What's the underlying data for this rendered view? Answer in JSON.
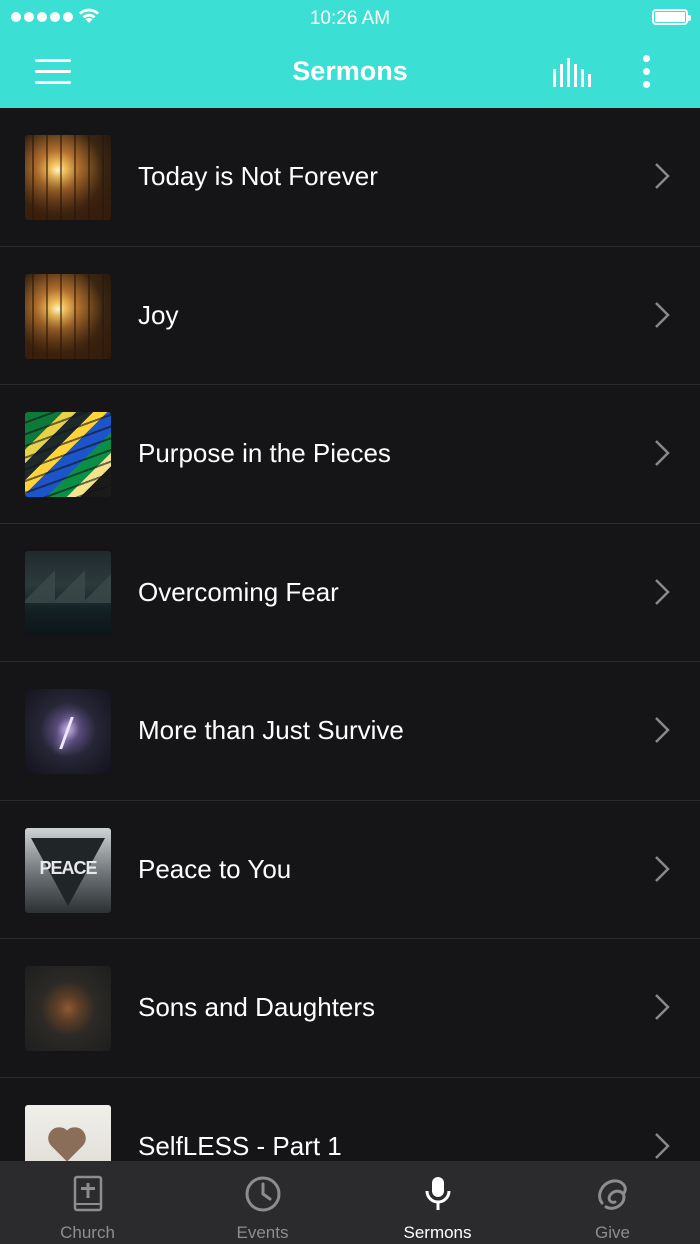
{
  "status_bar": {
    "time": "10:26 AM"
  },
  "header": {
    "title": "Sermons"
  },
  "sermons": [
    {
      "title": "Today is Not Forever",
      "thumbnail": "sunset-wheat"
    },
    {
      "title": "Joy",
      "thumbnail": "sunset-wheat"
    },
    {
      "title": "Purpose in the Pieces",
      "thumbnail": "stained-glass"
    },
    {
      "title": "Overcoming Fear",
      "thumbnail": "mountain-lake"
    },
    {
      "title": "More than Just Survive",
      "thumbnail": "lightning-storm"
    },
    {
      "title": "Peace to You",
      "thumbnail": "peace-triangle",
      "thumbnail_text": "PEACE"
    },
    {
      "title": "Sons and Daughters",
      "thumbnail": "ground-dark"
    },
    {
      "title": "SelfLESS - Part 1",
      "thumbnail": "heart-hands"
    }
  ],
  "tabs": [
    {
      "label": "Church",
      "icon": "bible-icon",
      "active": false
    },
    {
      "label": "Events",
      "icon": "clock-icon",
      "active": false
    },
    {
      "label": "Sermons",
      "icon": "microphone-icon",
      "active": true
    },
    {
      "label": "Give",
      "icon": "give-icon",
      "active": false
    }
  ],
  "colors": {
    "accent": "#3cdfd3",
    "background": "#151517",
    "tabbar": "#2b2b2d",
    "tab_inactive": "#8d8d91"
  }
}
